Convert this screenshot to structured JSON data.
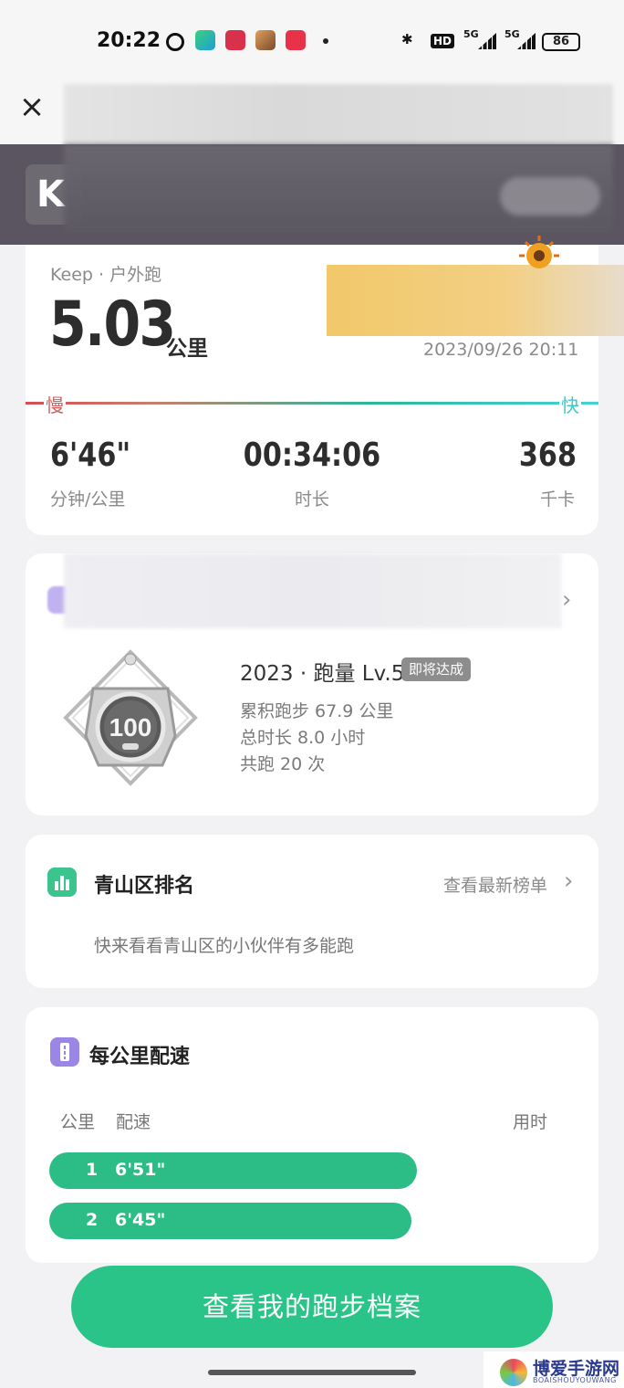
{
  "status_bar": {
    "time": "20:22",
    "hd": "HD",
    "net1": "5G",
    "net2": "5G",
    "battery": "86"
  },
  "nav": {
    "close_icon": "×"
  },
  "banner": {
    "logo": "K"
  },
  "workout": {
    "type": "Keep · 户外跑",
    "distance": "5.03",
    "distance_unit": "公里",
    "datetime": "2023/09/26 20:11",
    "slow_label": "慢",
    "fast_label": "快",
    "stats": [
      {
        "value": "6'46\"",
        "label": "分钟/公里"
      },
      {
        "value": "00:34:06",
        "label": "时长"
      },
      {
        "value": "368",
        "label": "千卡"
      }
    ]
  },
  "medal": {
    "title": "2023 · 跑量 Lv.5",
    "badge": "即将达成",
    "medal_number": "100",
    "lines": [
      "累积跑步 67.9 公里",
      "总时长 8.0 小时",
      "共跑 20 次"
    ]
  },
  "ranking": {
    "title": "青山区排名",
    "link": "查看最新榜单",
    "subtitle": "快来看看青山区的小伙伴有多能跑"
  },
  "pace": {
    "title": "每公里配速",
    "col_km": "公里",
    "col_pace": "配速",
    "col_time": "用时",
    "rows": [
      {
        "km": "1",
        "pace": "6'51\"",
        "fill": 0.64
      },
      {
        "km": "2",
        "pace": "6'45\"",
        "fill": 0.63
      }
    ]
  },
  "cta": {
    "label": "查看我的跑步档案"
  },
  "watermark": {
    "text": "博爱手游网",
    "sub": "BOAISHOUYOUWANG"
  }
}
